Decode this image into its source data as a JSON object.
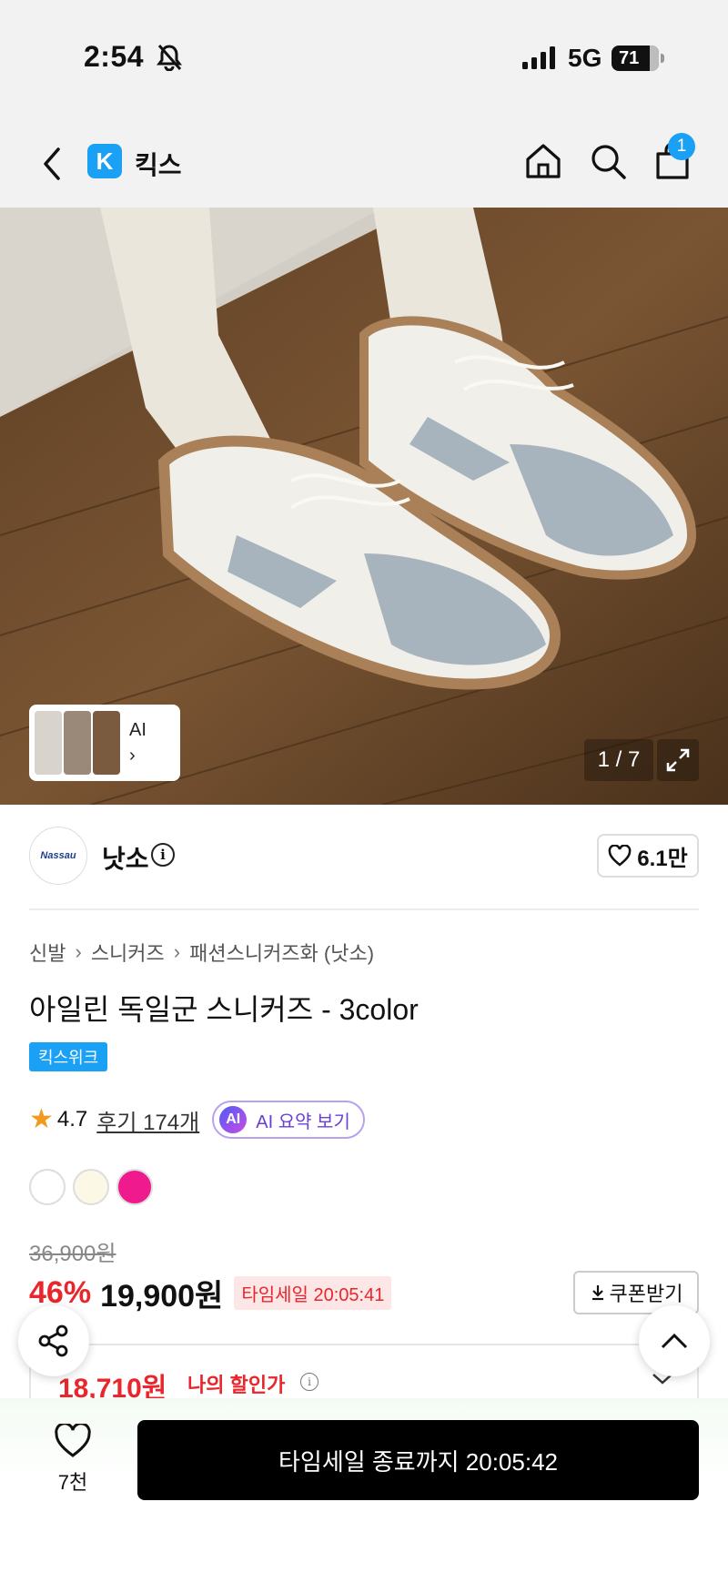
{
  "status_bar": {
    "time": "2:54",
    "network": "5G",
    "battery": "71"
  },
  "header": {
    "brand_letter": "K",
    "brand_name": "킥스",
    "cart_count": "1"
  },
  "gallery": {
    "thumb_label": "AI",
    "thumb_chevron": "›",
    "counter": "1 / 7"
  },
  "store": {
    "logo_text": "Nassau",
    "name": "낫소",
    "info": "i",
    "likes": "6.1만"
  },
  "breadcrumb": [
    "신발",
    "스니커즈",
    "패션스니커즈화 (낫소)"
  ],
  "product": {
    "title": "아일린 독일군 스니커즈 - 3color",
    "tag": "킥스위크",
    "rating": "4.7",
    "reviews": "후기 174개",
    "ai_badge": "AI",
    "ai_summary": "AI 요약 보기",
    "colors": [
      "#ffffff",
      "#fbf8e6",
      "#ef1a8e"
    ]
  },
  "price": {
    "original": "36,900원",
    "discount": "46%",
    "sale": "19,900원",
    "timer": "타임세일 20:05:41",
    "coupon": "쿠폰받기",
    "my_price": "18,710원",
    "my_price_label": "나의 할인가"
  },
  "bottom": {
    "wish_count": "7천",
    "cta": "타임세일 종료까지 20:05:42"
  },
  "colors": {
    "accent": "#1aa0f5",
    "sale_red": "#e8262b",
    "ai_purple": "#6a3fd8"
  }
}
